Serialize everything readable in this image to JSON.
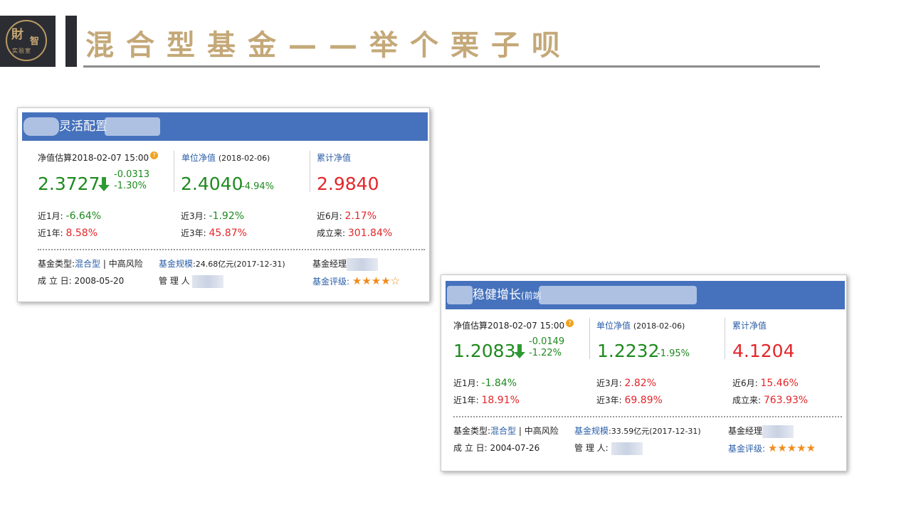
{
  "logo": {
    "main": "財",
    "side": "智",
    "sub": "实验室"
  },
  "title": "混合型基金——举个栗子呗",
  "cards": [
    {
      "name": "灵活配置",
      "name_sub": "",
      "est": {
        "label": "净值估算",
        "time": "2018-02-07 15:00",
        "value": "2.3727",
        "change": "-0.0313",
        "pct": "-1.30%"
      },
      "unit": {
        "label": "单位净值",
        "date": "(2018-02-06)",
        "value": "2.4040",
        "pct": "-4.94%"
      },
      "cum": {
        "label": "累计净值",
        "value": "2.9840"
      },
      "perf": [
        {
          "label": "近1月:",
          "value": "-6.64%",
          "color": "green"
        },
        {
          "label": "近3月:",
          "value": "-1.92%",
          "color": "green"
        },
        {
          "label": "近6月:",
          "value": "2.17%",
          "color": "red"
        },
        {
          "label": "近1年:",
          "value": "8.58%",
          "color": "red"
        },
        {
          "label": "近3年:",
          "value": "45.87%",
          "color": "red"
        },
        {
          "label": "成立来:",
          "value": "301.84%",
          "color": "red"
        }
      ],
      "type_label": "基金类型:",
      "type_value": "混合型",
      "risk": "中高风险",
      "scale_label": "基金规模",
      "scale_value": ":24.68亿元(2017-12-31)",
      "manager_label": "基金经理",
      "found_label": "成 立 日:",
      "found_value": "2008-05-20",
      "admin_label": "管 理 人",
      "rating_label": "基金评级:",
      "rating": "★★★★☆"
    },
    {
      "name": "稳健增长",
      "name_sub": "(前端",
      "est": {
        "label": "净值估算",
        "time": "2018-02-07 15:00",
        "value": "1.2083",
        "change": "-0.0149",
        "pct": "-1.22%"
      },
      "unit": {
        "label": "单位净值",
        "date": "(2018-02-06)",
        "value": "1.2232",
        "pct": "-1.95%"
      },
      "cum": {
        "label": "累计净值",
        "value": "4.1204"
      },
      "perf": [
        {
          "label": "近1月:",
          "value": "-1.84%",
          "color": "green"
        },
        {
          "label": "近3月:",
          "value": "2.82%",
          "color": "red"
        },
        {
          "label": "近6月:",
          "value": "15.46%",
          "color": "red"
        },
        {
          "label": "近1年:",
          "value": "18.91%",
          "color": "red"
        },
        {
          "label": "近3年:",
          "value": "69.89%",
          "color": "red"
        },
        {
          "label": "成立来:",
          "value": "763.93%",
          "color": "red"
        }
      ],
      "type_label": "基金类型:",
      "type_value": "混合型",
      "risk": "中高风险",
      "scale_label": "基金规模",
      "scale_value": ":33.59亿元(2017-12-31)",
      "manager_label": "基金经理",
      "found_label": "成 立 日:",
      "found_value": "2004-07-26",
      "admin_label": "管 理 人:",
      "rating_label": "基金评级:",
      "rating": "★★★★★"
    }
  ],
  "colors": {
    "header_blue": "#4672bd",
    "gold": "#c4a878",
    "green": "#1e8a1e",
    "red": "#e3262a",
    "star": "#f08c1a"
  }
}
